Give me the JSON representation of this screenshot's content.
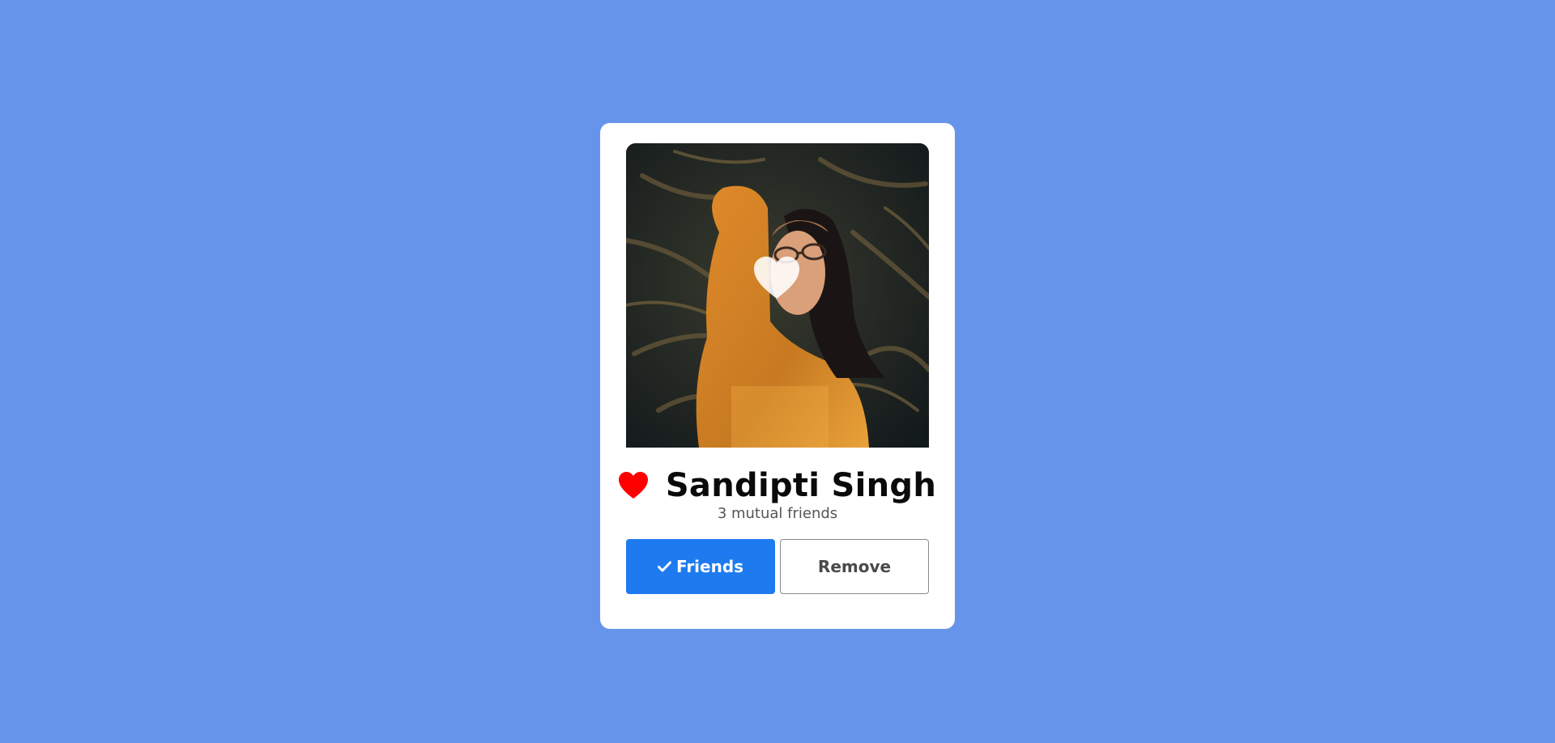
{
  "profile": {
    "name": "Sandipti Singh",
    "mutual": "3 mutual friends",
    "photo_description_icon": "heart-icon"
  },
  "actions": {
    "friends_label": "Friends",
    "remove_label": "Remove"
  },
  "colors": {
    "background": "#6694EB",
    "card": "#ffffff",
    "primary_button": "#1E7BEF",
    "heart": "#FF0000"
  }
}
